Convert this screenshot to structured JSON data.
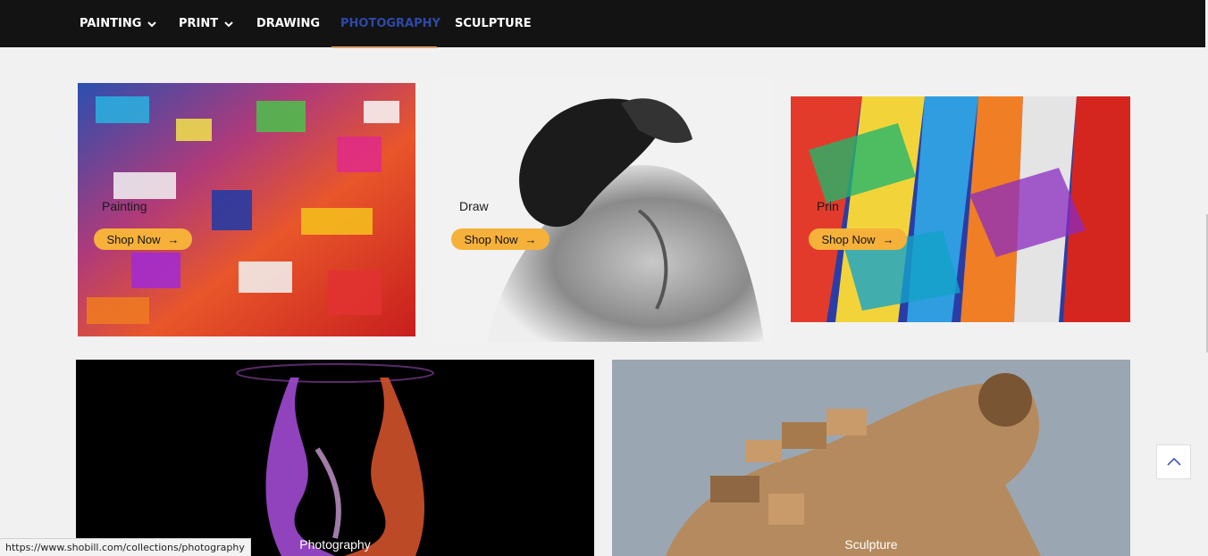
{
  "nav": {
    "items": [
      {
        "label": "PAINTING",
        "has_dropdown": true
      },
      {
        "label": "PRINT",
        "has_dropdown": true
      },
      {
        "label": "DRAWING",
        "has_dropdown": false
      },
      {
        "label": "PHOTOGRAPHY",
        "has_dropdown": false,
        "active": true
      },
      {
        "label": "SCULPTURE",
        "has_dropdown": false
      }
    ],
    "active_color": "#2d49a8",
    "underline_color": "#d9a469"
  },
  "cards": {
    "painting": {
      "label": "Painting",
      "button": "Shop Now",
      "arrow": "→"
    },
    "drawing": {
      "label": "Draw",
      "button": "Shop Now",
      "arrow": "→"
    },
    "print": {
      "label": "Prin",
      "button": "Shop Now",
      "arrow": "→"
    },
    "photography": {
      "caption": "Photography"
    },
    "sculpture": {
      "caption": "Sculpture"
    }
  },
  "button_color": "#f6b13a",
  "back_to_top": {
    "icon": "chevron-up-icon"
  },
  "status_bar": {
    "url": "https://www.shobill.com/collections/photography"
  }
}
